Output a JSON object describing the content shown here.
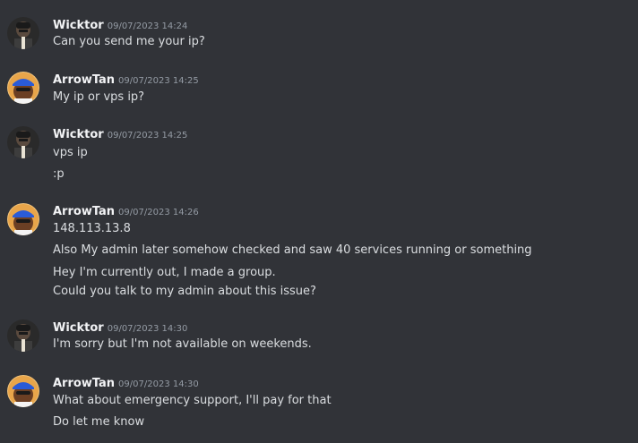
{
  "messages": [
    {
      "author": "Wicktor",
      "avatar": "wicktor-avatar",
      "timestamp": "09/07/2023 14:24",
      "lines": [
        "Can you send me your ip?"
      ]
    },
    {
      "author": "ArrowTan",
      "avatar": "arrowtan-avatar",
      "timestamp": "09/07/2023 14:25",
      "lines": [
        "My ip or vps ip?"
      ]
    },
    {
      "author": "Wicktor",
      "avatar": "wicktor-avatar",
      "timestamp": "09/07/2023 14:25",
      "lines": [
        "vps ip",
        ":p"
      ]
    },
    {
      "author": "ArrowTan",
      "avatar": "arrowtan-avatar",
      "timestamp": "09/07/2023 14:26",
      "lines": [
        "148.113.13.8",
        "Also My admin later somehow checked and saw 40 services running or something",
        "Hey I'm currently out, I made a group.",
        "Could you talk to my admin about this issue?"
      ]
    },
    {
      "author": "Wicktor",
      "avatar": "wicktor-avatar",
      "timestamp": "09/07/2023 14:30",
      "lines": [
        "I'm sorry but I'm not available on weekends."
      ]
    },
    {
      "author": "ArrowTan",
      "avatar": "arrowtan-avatar",
      "timestamp": "09/07/2023 14:30",
      "lines": [
        "What about emergency support, I'll pay for that",
        "Do let me know"
      ]
    }
  ],
  "colors": {
    "background": "#313338",
    "username": "#f2f3f5",
    "timestamp": "#949ba4",
    "text": "#dbdee1"
  }
}
